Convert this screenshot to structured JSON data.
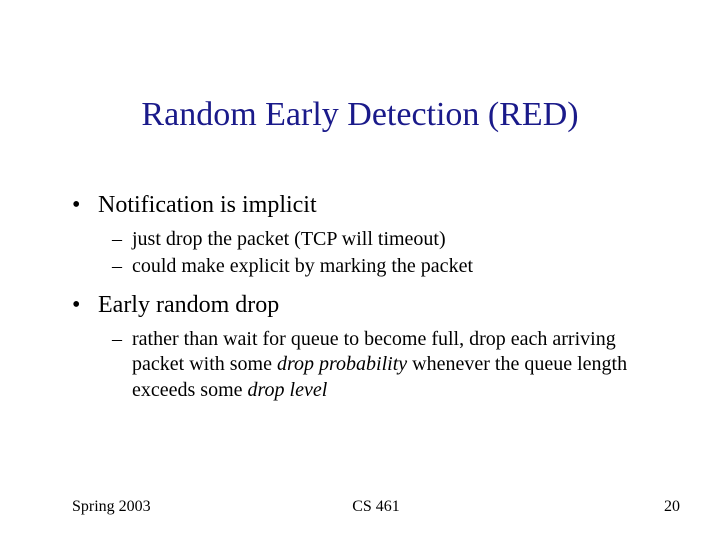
{
  "title": "Random Early Detection (RED)",
  "bullets": {
    "b1": "Notification is implicit",
    "b1s1": "just drop the packet (TCP will timeout)",
    "b1s2": "could make explicit by marking the packet",
    "b2": "Early random drop",
    "b2s1_a": "rather than wait for queue to become full, drop each arriving packet with some ",
    "b2s1_b": "drop probability",
    "b2s1_c": " whenever the queue length exceeds some ",
    "b2s1_d": "drop level"
  },
  "footer": {
    "left": "Spring 2003",
    "center": "CS 461",
    "right": "20"
  }
}
